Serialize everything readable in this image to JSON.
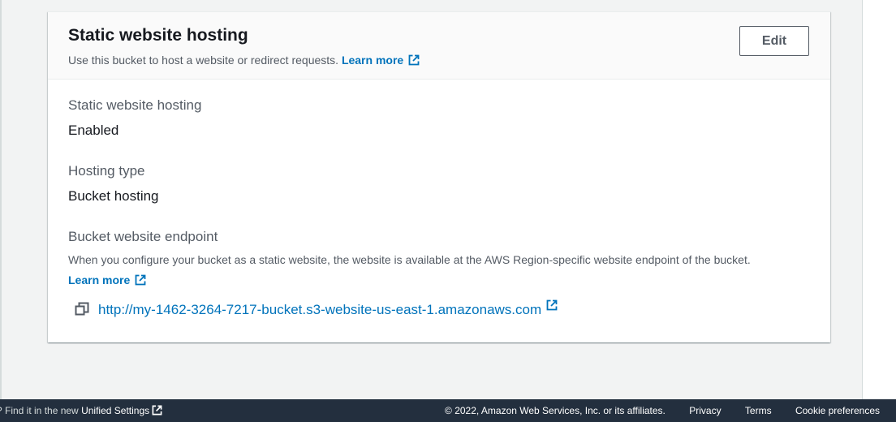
{
  "panel": {
    "title": "Static website hosting",
    "description": "Use this bucket to host a website or redirect requests.",
    "learn_more": "Learn more",
    "edit_label": "Edit"
  },
  "fields": {
    "hosting": {
      "label": "Static website hosting",
      "value": "Enabled"
    },
    "type": {
      "label": "Hosting type",
      "value": "Bucket hosting"
    },
    "endpoint": {
      "label": "Bucket website endpoint",
      "description": "When you configure your bucket as a static website, the website is available at the AWS Region-specific website endpoint of the bucket.",
      "learn_more": "Learn more",
      "url": "http://my-1462-3264-7217-bucket.s3-website-us-east-1.amazonaws.com"
    }
  },
  "footer": {
    "prompt": "? Find it in the new",
    "settings_link": "Unified Settings",
    "copyright": "© 2022, Amazon Web Services, Inc. or its affiliates.",
    "privacy": "Privacy",
    "terms": "Terms",
    "cookies": "Cookie preferences"
  },
  "colors": {
    "link": "#0073bb",
    "footer_bg": "#232f3e",
    "page_bg": "#f2f3f3"
  },
  "icons": {
    "external": "external-link-icon",
    "copy": "copy-icon"
  }
}
